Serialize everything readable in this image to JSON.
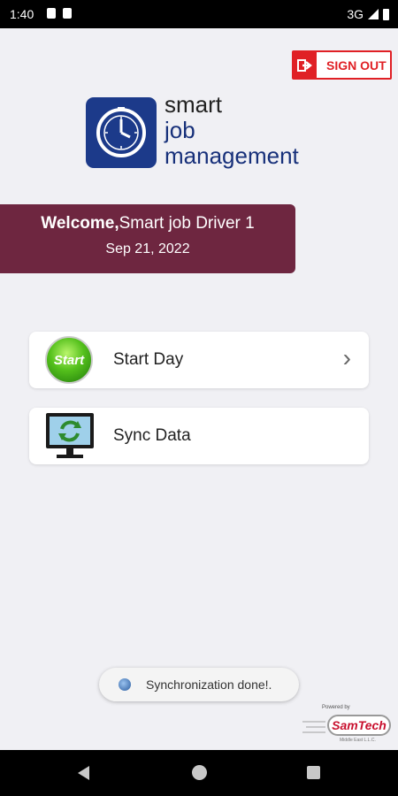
{
  "status_bar": {
    "time": "1:40",
    "network": "3G",
    "icons": [
      "sim-icon",
      "storage-icon",
      "signal-icon",
      "battery-icon"
    ]
  },
  "header": {
    "signout_label": "SIGN OUT",
    "signout_icon": "sign-out-icon"
  },
  "logo": {
    "line1": "smart",
    "line2": "job",
    "line3": "management",
    "icon": "clock-icon",
    "color": "#1c3a8a"
  },
  "welcome": {
    "prefix": "Welcome,",
    "name": "Smart job Driver 1",
    "date": "Sep 21, 2022",
    "color": "#6e2640"
  },
  "menu": {
    "items": [
      {
        "label": "Start Day",
        "icon_text": "Start",
        "icon": "start-button-icon",
        "has_chevron": true
      },
      {
        "label": "Sync Data",
        "icon": "sync-monitor-icon",
        "has_chevron": false
      }
    ],
    "chevron": "›"
  },
  "toast": {
    "text": "Synchronization done!."
  },
  "branding": {
    "powered": "Powered by",
    "name": "SamTech",
    "sub": "Middle East L.L.C."
  },
  "nav": {
    "icons": [
      "back-icon",
      "home-icon",
      "recents-icon"
    ]
  },
  "colors": {
    "accent_red": "#e02025",
    "background": "#f0f0f4"
  }
}
